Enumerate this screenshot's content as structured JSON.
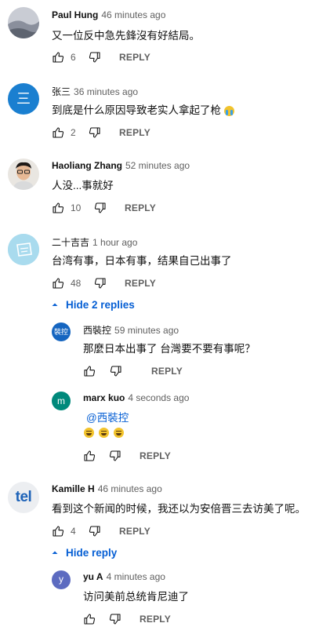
{
  "comments": [
    {
      "author": "Paul Hung",
      "time": "46 minutes ago",
      "text": "又一位反中急先鋒沒有好結局。",
      "likes": "6",
      "reply": "REPLY",
      "avatar": "landscape-photo"
    },
    {
      "author": "张三",
      "time": "36 minutes ago",
      "text": "到底是什么原因导致老实人拿起了枪",
      "likes": "2",
      "reply": "REPLY",
      "avatar_text": "三",
      "avatar_color": "#1a7fd0"
    },
    {
      "author": "Haoliang Zhang",
      "time": "52 minutes ago",
      "text": "人没...事就好",
      "likes": "10",
      "reply": "REPLY",
      "avatar": "person-photo"
    },
    {
      "author": "二十吉吉",
      "time": "1 hour ago",
      "text": "台湾有事，日本有事，结果自己出事了",
      "likes": "48",
      "reply": "REPLY",
      "avatar": "light-blue-drawing",
      "toggle": "Hide 2 replies",
      "replies": [
        {
          "author": "西裝控",
          "time": "59 minutes ago",
          "text": "那麼日本出事了 台灣要不要有事呢？",
          "reply": "REPLY",
          "avatar_text": "裝控",
          "avatar_color": "#1565c0"
        },
        {
          "author": "marx kuo",
          "time": "4 seconds ago",
          "mention": "@西裝控",
          "reply": "REPLY",
          "avatar_text": "m",
          "avatar_color": "#00897b"
        }
      ]
    },
    {
      "author": "Kamille H",
      "time": "46 minutes ago",
      "text": "看到这个新闻的时候，我还以为安倍晋三去访美了呢。",
      "likes": "4",
      "reply": "REPLY",
      "avatar_text": "tel",
      "avatar_color": "#1e63b8",
      "toggle": "Hide reply",
      "replies": [
        {
          "author": "yu A",
          "time": "4 minutes ago",
          "text": "访问美前总统肯尼迪了",
          "reply": "REPLY",
          "avatar_text": "y",
          "avatar_color": "#5c6bc0"
        }
      ]
    }
  ]
}
